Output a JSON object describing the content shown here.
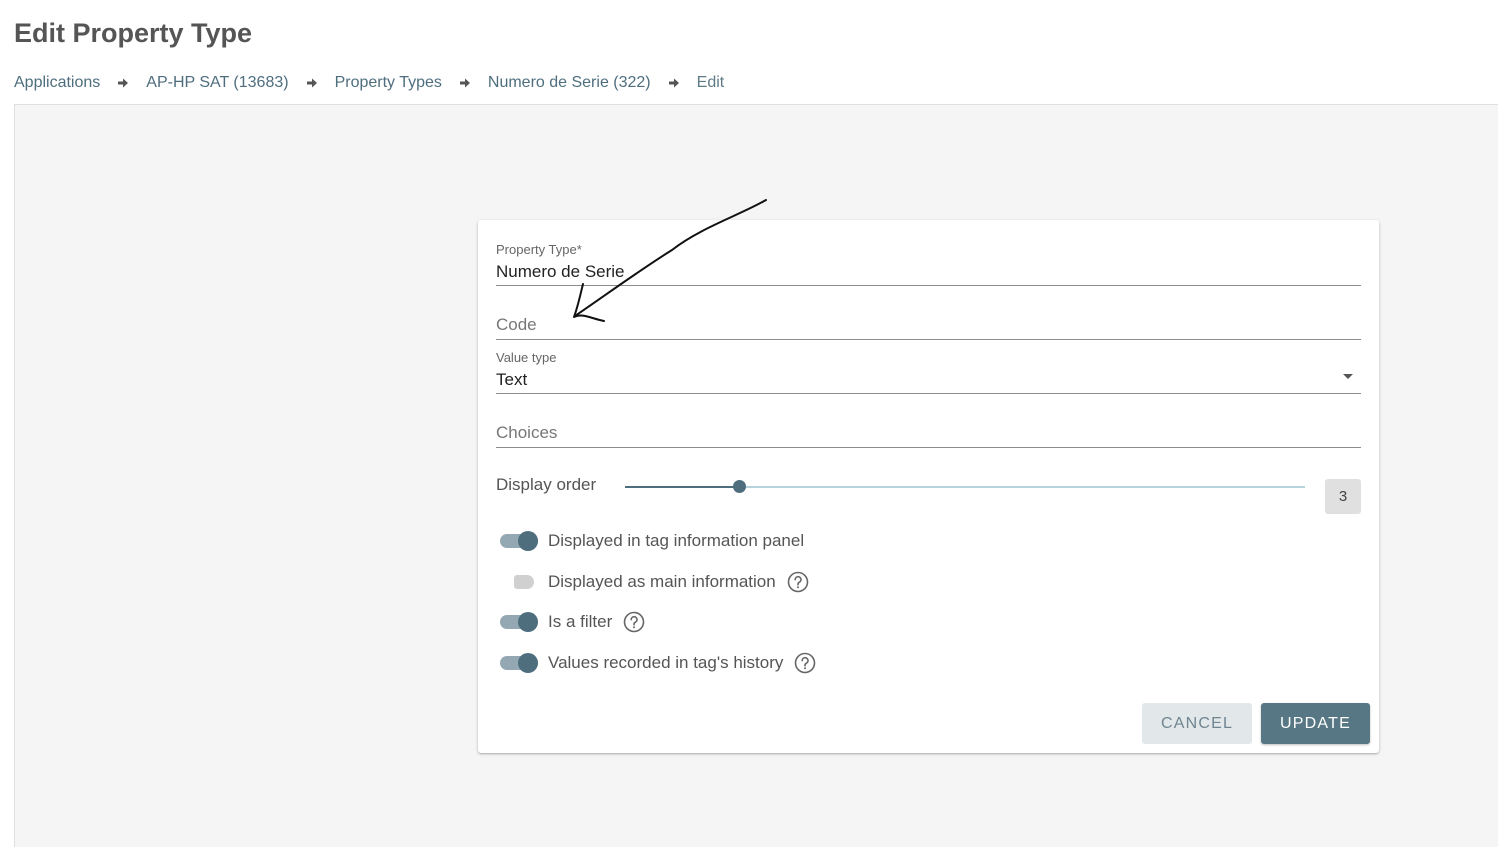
{
  "page": {
    "title": "Edit Property Type"
  },
  "breadcrumb": {
    "items": [
      "Applications",
      "AP-HP SAT (13683)",
      "Property Types",
      "Numero de Serie (322)",
      "Edit"
    ],
    "separator_icon": "arrow-right-icon"
  },
  "form": {
    "property_type": {
      "label": "Property Type*",
      "value": "Numero de Serie"
    },
    "code": {
      "placeholder": "Code",
      "value": ""
    },
    "value_type": {
      "label": "Value type",
      "value": "Text"
    },
    "choices": {
      "placeholder": "Choices",
      "value": ""
    },
    "display_order": {
      "label": "Display order",
      "value": "3",
      "slider_fraction": 0.167
    },
    "toggles": [
      {
        "label": "Displayed in tag information panel",
        "on": true,
        "help": false
      },
      {
        "label": "Displayed as main information",
        "on": false,
        "help": true
      },
      {
        "label": "Is a filter",
        "on": true,
        "help": true
      },
      {
        "label": "Values recorded in tag's history",
        "on": true,
        "help": true
      }
    ]
  },
  "actions": {
    "cancel_label": "CANCEL",
    "update_label": "UPDATE"
  },
  "colors": {
    "accent": "#4e6e7e",
    "button_primary": "#587784",
    "button_secondary": "#e2e7e9",
    "content_background": "#f5f5f5"
  },
  "icons": {
    "help": "question-circle-icon",
    "select": "caret-down-icon"
  }
}
